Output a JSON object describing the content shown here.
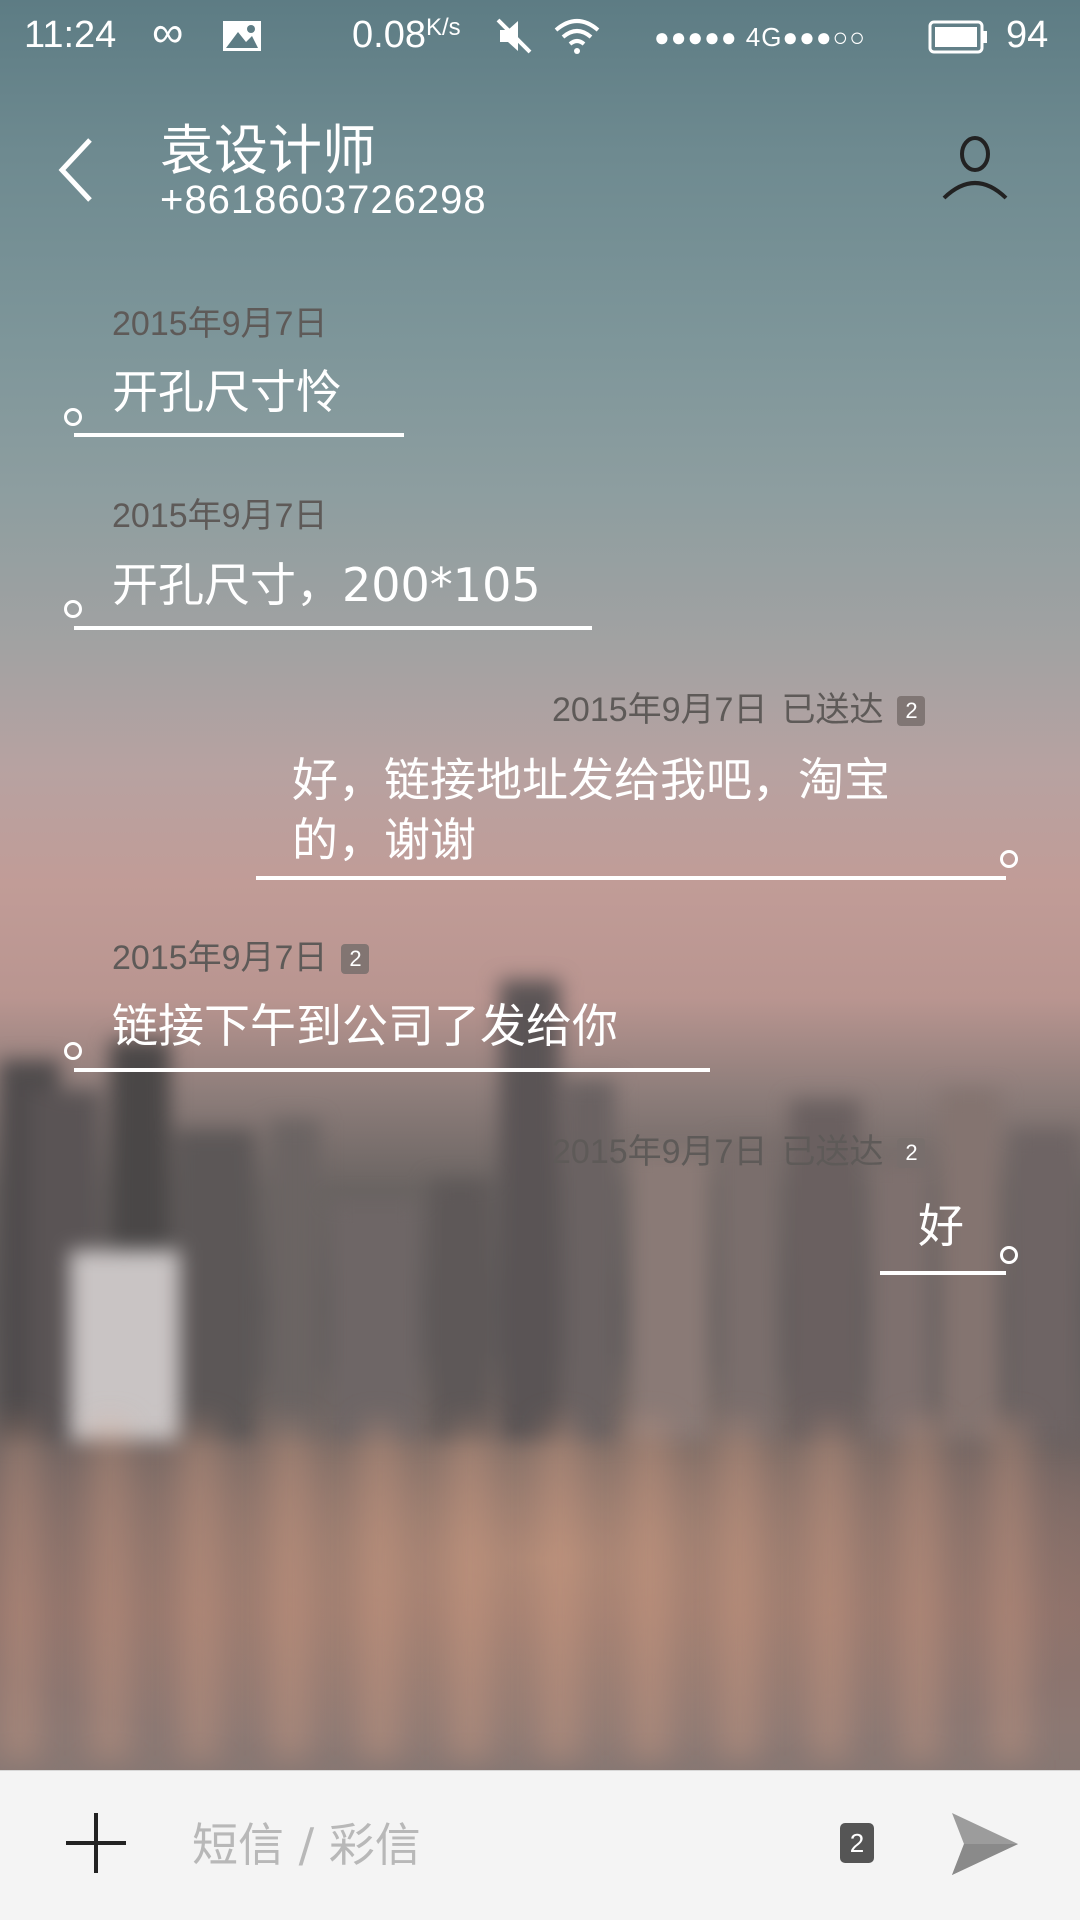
{
  "status_bar": {
    "time": "11:24",
    "speed": "0.08",
    "speed_unit": "K/s",
    "network": "●●●●● 4G●●●○○",
    "battery": "94"
  },
  "header": {
    "contact_name": "袁设计师",
    "contact_number": "+8618603726298"
  },
  "messages": [
    {
      "direction": "incoming",
      "date": "2015年9月7日",
      "status": "",
      "sim": "",
      "text": "开孔尺寸怜"
    },
    {
      "direction": "incoming",
      "date": "2015年9月7日",
      "status": "",
      "sim": "",
      "text": "开孔尺寸，200*105"
    },
    {
      "direction": "outgoing",
      "date": "2015年9月7日",
      "status": "已送达",
      "sim": "2",
      "text_line1": "好，链接地址发给我吧，淘宝",
      "text_line2": "的，谢谢"
    },
    {
      "direction": "incoming",
      "date": "2015年9月7日",
      "status": "",
      "sim": "2",
      "text": "链接下午到公司了发给你"
    },
    {
      "direction": "outgoing",
      "date": "2015年9月7日",
      "status": "已送达",
      "sim": "2",
      "text": "好"
    }
  ],
  "composer": {
    "placeholder": "短信 / 彩信",
    "sim": "2"
  },
  "icons": {
    "back": "chevron-left-icon",
    "profile": "person-icon",
    "add": "plus-icon",
    "send": "send-icon",
    "infinity": "infinity-icon",
    "photo": "image-icon",
    "mute": "mute-icon",
    "wifi": "wifi-icon",
    "battery": "battery-icon"
  }
}
